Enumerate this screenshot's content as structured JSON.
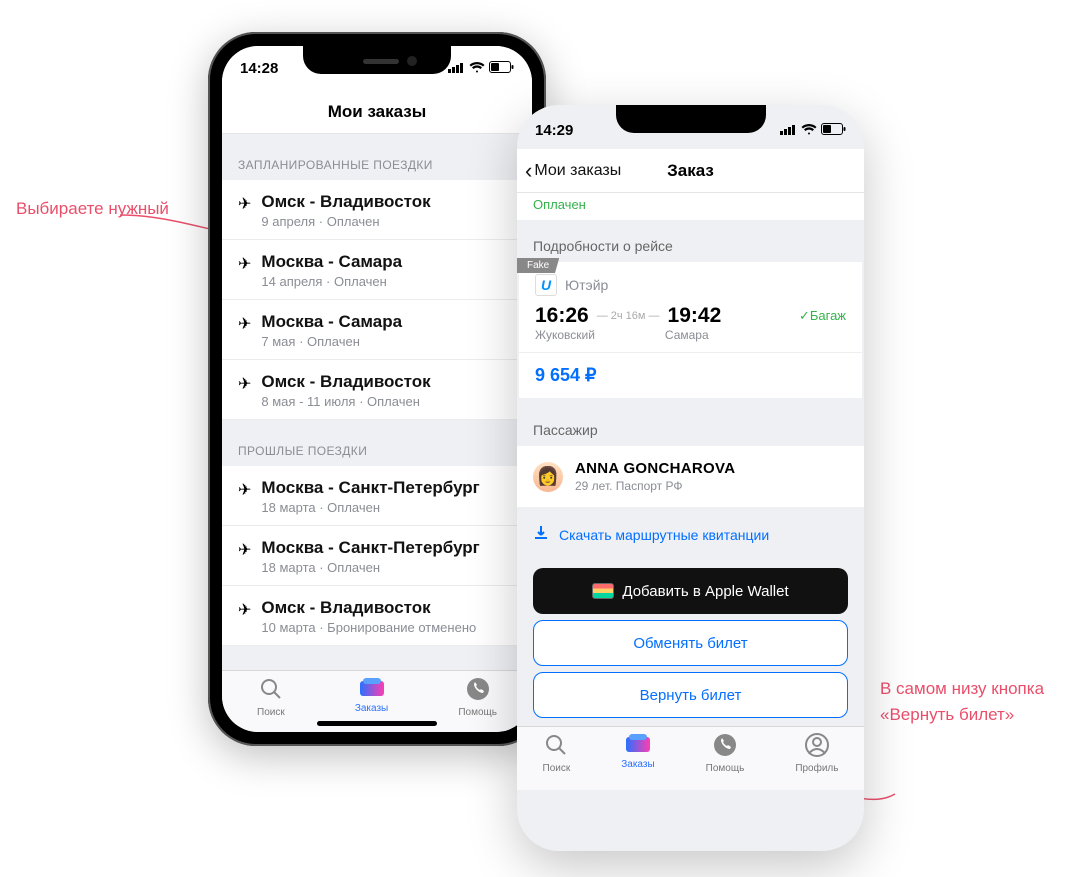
{
  "annotations": {
    "left": "Выбираете нужный",
    "right": "В самом низу кнопка «Вернуть билет»"
  },
  "phone_left": {
    "status_time": "14:28",
    "nav_title": "Мои заказы",
    "section_planned": "ЗАПЛАНИРОВАННЫЕ ПОЕЗДКИ",
    "section_past": "ПРОШЛЫЕ ПОЕЗДКИ",
    "orders_planned": [
      {
        "route": "Омск - Владивосток",
        "sub": "9 апреля · Оплачен"
      },
      {
        "route": "Москва - Самара",
        "sub": "14 апреля · Оплачен"
      },
      {
        "route": "Москва - Самара",
        "sub": "7 мая · Оплачен"
      },
      {
        "route": "Омск - Владивосток",
        "sub": "8 мая - 11 июля · Оплачен"
      }
    ],
    "orders_past": [
      {
        "route": "Москва - Санкт-Петербург",
        "sub": "18 марта · Оплачен"
      },
      {
        "route": "Москва - Санкт-Петербург",
        "sub": "18 марта · Оплачен"
      },
      {
        "route": "Омск - Владивосток",
        "sub": "10 марта · Бронирование отменено"
      }
    ],
    "tabs": {
      "search": "Поиск",
      "orders": "Заказы",
      "help": "Помощь"
    }
  },
  "phone_right": {
    "status_time": "14:29",
    "back_label": "Мои заказы",
    "nav_title": "Заказ",
    "paid_label": "Оплачен",
    "details_header": "Подробности о рейсе",
    "fake_tag": "Fake",
    "airline": "Ютэйр",
    "dep_time": "16:26",
    "duration": "2ч 16м",
    "arr_time": "19:42",
    "luggage": "✓Багаж",
    "dep_city": "Жуковский",
    "arr_city": "Самара",
    "price": "9 654 ₽",
    "passenger_header": "Пассажир",
    "passenger_name": "ANNA GONCHAROVA",
    "passenger_sub": "29 лет. Паспорт РФ",
    "download_label": "Скачать маршрутные квитанции",
    "wallet_label": "Добавить в Apple Wallet",
    "exchange_label": "Обменять билет",
    "return_label": "Вернуть билет",
    "tabs": {
      "search": "Поиск",
      "orders": "Заказы",
      "help": "Помощь",
      "profile": "Профиль"
    }
  }
}
